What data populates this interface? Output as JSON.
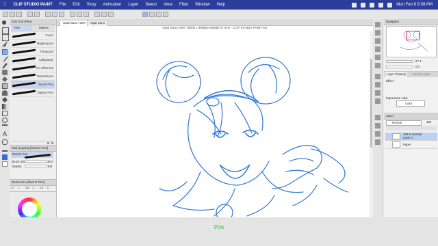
{
  "menubar": {
    "app": "CLIP STUDIO PAINT",
    "items": [
      "File",
      "Edit",
      "Story",
      "Animation",
      "Layer",
      "Select",
      "View",
      "Filter",
      "Window",
      "Help"
    ],
    "clock": "Mon Feb 8  9:58 PM"
  },
  "subtool": {
    "header": "Sub Tool [Pen]",
    "tabs": [
      "Pen",
      "Marker"
    ],
    "brushes": [
      "G-pen",
      "Mapping pen",
      "Turnip pen",
      "Calligraphy",
      "For effect line",
      "Textured pen",
      "Real G-Pen",
      "Tapered Pen"
    ],
    "selected_index": 6
  },
  "toolprop": {
    "header": "Tool property [Real G-Pen]",
    "name": "Real G-Pen",
    "brush_size_label": "Brush Size",
    "brush_size_value": "36.0",
    "opacity_label": "Opacity",
    "opacity_value": "100"
  },
  "brushsize": {
    "header": "Brush size [Real G-Pen]",
    "values": [
      "0.7",
      "1",
      "1.5",
      "2",
      "2.5",
      "3",
      "4",
      "5",
      "6",
      "7",
      "8",
      "10"
    ]
  },
  "document": {
    "tabs": [
      "Opal Sano Here*",
      "Opal Sano"
    ],
    "title": "Opal Sano Here* (8000 x 4900px 600dpi 67.4%) - CLIP STUDIO PAINT EX"
  },
  "navigator": {
    "header": "Navigator",
    "zoom": "67.4",
    "angle": "0.0"
  },
  "layerprop": {
    "tabs": [
      "Layer Property",
      "Search Layer"
    ],
    "effect_label": "Effect",
    "expression_label": "Expression color",
    "expression_value": "Color"
  },
  "layers": {
    "header": "Layer",
    "blend": "Normal",
    "opacity": "100",
    "items": [
      {
        "name": "100 % Normal",
        "sub": "Layer 1",
        "selected": true
      },
      {
        "name": "Paper",
        "sub": "",
        "selected": false
      }
    ]
  },
  "caption": "Pen",
  "colors": {
    "accent": "#2c3e9a",
    "sketch": "#3b7fd6",
    "caption": "#39c73a"
  }
}
